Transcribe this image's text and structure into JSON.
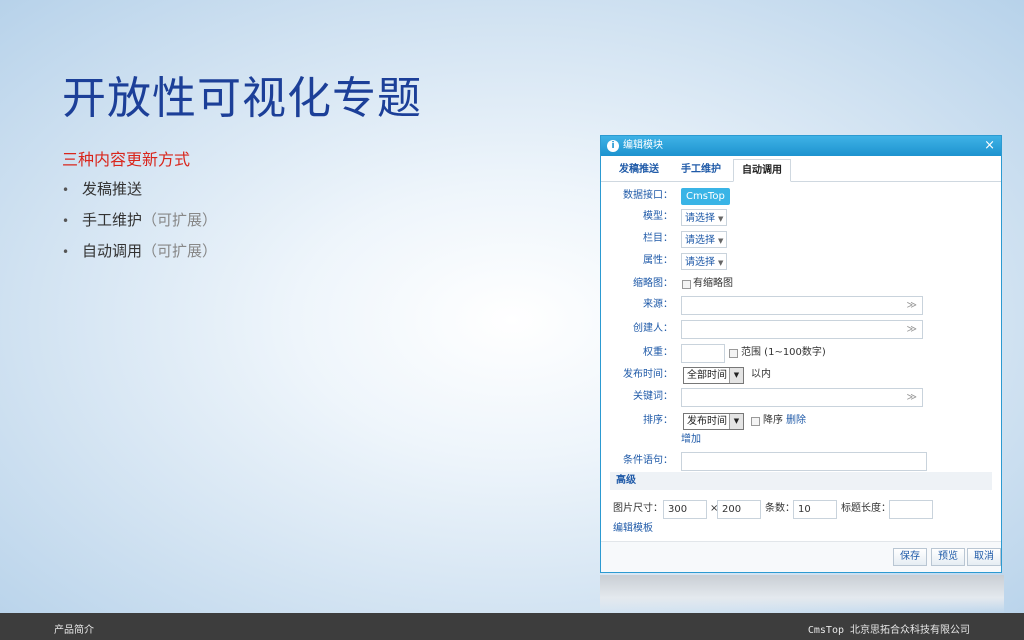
{
  "slide": {
    "title": "开放性可视化专题",
    "subtitle": "三种内容更新方式",
    "bullets": [
      {
        "text": "发稿推送",
        "note": ""
      },
      {
        "text": "手工维护",
        "note": "（可扩展）"
      },
      {
        "text": "自动调用",
        "note": "（可扩展）"
      }
    ],
    "bullet_char": "•"
  },
  "footer": {
    "left": "产品简介",
    "brand": "CmsTop",
    "company": "北京思拓合众科技有限公司"
  },
  "dialog": {
    "title": "编辑模块",
    "info_icon": "i",
    "close": "×",
    "tabs": [
      "发稿推送",
      "手工维护",
      "自动调用"
    ],
    "active_tab": "自动调用",
    "fields": {
      "data_interface": {
        "label": "数据接口：",
        "value": "CmsTop"
      },
      "model": {
        "label": "模型：",
        "value": "请选择"
      },
      "column": {
        "label": "栏目：",
        "value": "请选择"
      },
      "attribute": {
        "label": "属性：",
        "value": "请选择"
      },
      "thumbnail": {
        "label": "缩略图：",
        "checkbox_label": "有缩略图"
      },
      "source": {
        "label": "来源：",
        "value": ""
      },
      "creator": {
        "label": "创建人：",
        "value": ""
      },
      "weight": {
        "label": "权重：",
        "value": "",
        "range_label": "范围 (1~100数字)"
      },
      "publish_time": {
        "label": "发布时间：",
        "value": "全部时间",
        "suffix": "以内"
      },
      "keywords": {
        "label": "关键词：",
        "value": ""
      },
      "sort": {
        "label": "排序：",
        "value": "发布时间",
        "desc_label": "降序",
        "delete": "删除",
        "add": "增加"
      },
      "condition": {
        "label": "条件语句：",
        "value": ""
      }
    },
    "advanced": "高级",
    "image_size_label": "图片尺寸：",
    "image_width": "300",
    "image_times": "×",
    "image_height": "200",
    "count_label": "条数：",
    "count_value": "10",
    "title_length_label": "标题长度：",
    "title_length_value": "",
    "edit_template": "编辑模板",
    "buttons": {
      "save": "保存",
      "preview": "预览",
      "cancel": "取消"
    },
    "chevron": "≫",
    "caret": "▼"
  }
}
